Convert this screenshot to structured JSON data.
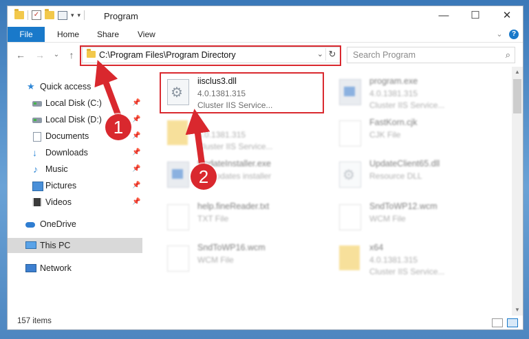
{
  "window": {
    "title": "Program",
    "controls": {
      "minimize": "—",
      "maximize": "☐",
      "close": "✕"
    }
  },
  "ribbon": {
    "tabs": [
      {
        "label": "File"
      },
      {
        "label": "Home"
      },
      {
        "label": "Share"
      },
      {
        "label": "View"
      }
    ],
    "expand_glyph": "⌄",
    "help_glyph": "?"
  },
  "address": {
    "path": "C:\\Program Files\\Program Directory",
    "search_placeholder": "Search Program"
  },
  "sidebar": {
    "items": [
      {
        "label": "Quick access",
        "icon": "star-icon"
      },
      {
        "label": "Local Disk (C:)",
        "icon": "drive-icon"
      },
      {
        "label": "Local Disk (D:)",
        "icon": "drive-icon"
      },
      {
        "label": "Documents",
        "icon": "documents-icon"
      },
      {
        "label": "Downloads",
        "icon": "downloads-icon"
      },
      {
        "label": "Music",
        "icon": "music-icon"
      },
      {
        "label": "Pictures",
        "icon": "pictures-icon"
      },
      {
        "label": "Videos",
        "icon": "videos-icon"
      },
      {
        "label": "OneDrive",
        "icon": "cloud-icon"
      },
      {
        "label": "This PC",
        "icon": "computer-icon"
      },
      {
        "label": "Network",
        "icon": "network-icon"
      }
    ]
  },
  "files": [
    {
      "name": "iisclus3.dll",
      "line2": "4.0.1381.315",
      "line3": "Cluster IIS Service..."
    },
    {
      "name": "program.exe",
      "line2": "4.0.1381.315",
      "line3": "Cluster IIS Service..."
    },
    {
      "name": "",
      "line2": "4.0.1381.315",
      "line3": "Cluster IIS Service..."
    },
    {
      "name": "FastKorn.cjk",
      "line2": "CJK File",
      "line3": ""
    },
    {
      "name": "UpdateInstaller.exe",
      "line2": "UP updates installer",
      "line3": ""
    },
    {
      "name": "UpdateClient65.dll",
      "line2": "Resource DLL",
      "line3": ""
    },
    {
      "name": "help.fineReader.txt",
      "line2": "TXT File",
      "line3": ""
    },
    {
      "name": "SndToWP12.wcm",
      "line2": "WCM File",
      "line3": ""
    },
    {
      "name": "SndToWP16.wcm",
      "line2": "WCM File",
      "line3": ""
    },
    {
      "name": "x64",
      "line2": "4.0.1381.315",
      "line3": "Cluster IIS Service..."
    }
  ],
  "status": {
    "count": "157 items"
  },
  "annotations": {
    "step1": "1",
    "step2": "2"
  },
  "colors": {
    "accent": "#1979ca",
    "callout": "#d9282e"
  }
}
